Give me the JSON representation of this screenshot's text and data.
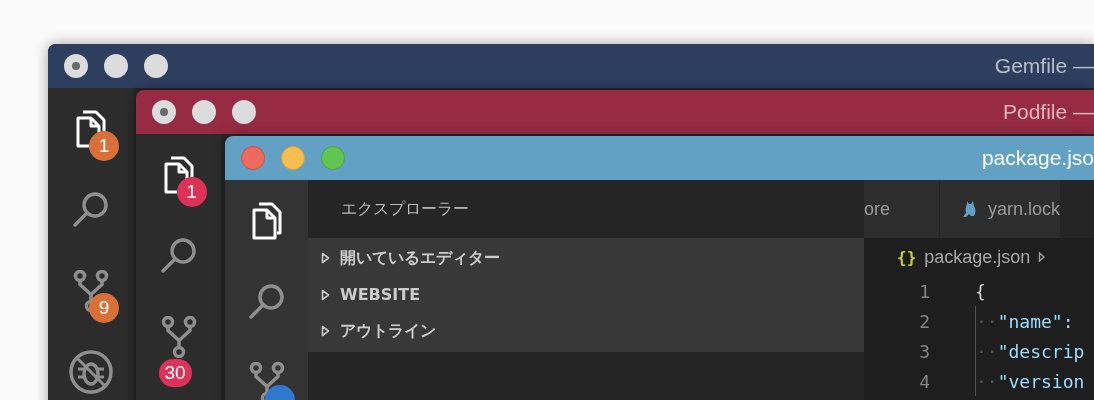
{
  "windows": [
    {
      "title": "Gemfile —",
      "active": false,
      "color": "#2e3e5e",
      "activity": [
        {
          "kind": "files",
          "selected": true,
          "badge": {
            "text": "1",
            "color": "#d9703a"
          }
        },
        {
          "kind": "search",
          "selected": false
        },
        {
          "kind": "git",
          "selected": false,
          "badge": {
            "text": "9",
            "color": "#d9703a"
          }
        },
        {
          "kind": "debug",
          "selected": false
        }
      ]
    },
    {
      "title": "Podfile —",
      "active": false,
      "color": "#962b43",
      "activity": [
        {
          "kind": "files",
          "selected": true,
          "badge": {
            "text": "1",
            "color": "#dd3157"
          }
        },
        {
          "kind": "search",
          "selected": false
        },
        {
          "kind": "git",
          "selected": false,
          "badge": {
            "text": "30",
            "color": "#dd3157"
          }
        }
      ]
    },
    {
      "title": "package.jso",
      "active": true,
      "color": "#62a0c4",
      "activity": [
        {
          "kind": "files",
          "selected": true
        },
        {
          "kind": "search",
          "selected": false
        },
        {
          "kind": "git",
          "selected": false,
          "badge": {
            "color": "#3078cc"
          }
        }
      ],
      "sidebar": {
        "title": "エクスプローラー",
        "sections": [
          {
            "label": "開いているエディター",
            "expanded": false
          },
          {
            "label": "WEBSITE",
            "expanded": false
          },
          {
            "label": "アウトライン",
            "expanded": false
          }
        ]
      },
      "tabs": [
        {
          "label": "ore",
          "selected": false,
          "kind": "partial"
        },
        {
          "label": "yarn.lock",
          "selected": false,
          "kind": "file"
        }
      ],
      "breadcrumb": {
        "icon": "{}",
        "file": "package.json"
      },
      "lines": [
        {
          "number": "1",
          "code": "{",
          "kind": "brace"
        },
        {
          "number": "2",
          "indent": "··",
          "code": "\"name\":",
          "kind": "key"
        },
        {
          "number": "3",
          "indent": "··",
          "code": "\"descrip",
          "kind": "key"
        },
        {
          "number": "4",
          "indent": "··",
          "code": "\"version",
          "kind": "key"
        }
      ]
    }
  ]
}
